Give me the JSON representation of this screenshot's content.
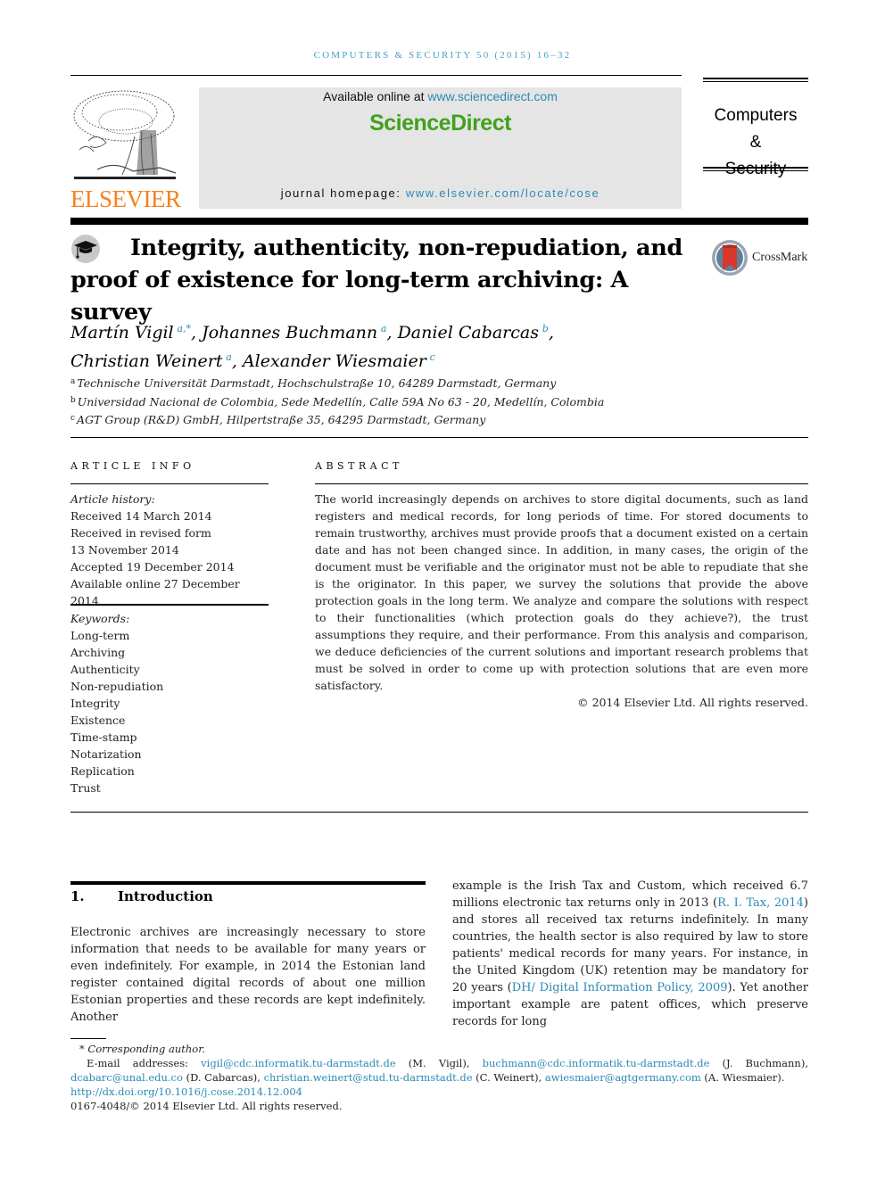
{
  "running_head": "COMPUTERS & SECURITY 50 (2015) 16–32",
  "publisher": {
    "logo_text": "ELSEVIER",
    "logo_color": "#f58220"
  },
  "sciencedirect": {
    "available_prefix": "Available online at ",
    "available_link": "www.sciencedirect.com",
    "brand": "ScienceDirect",
    "brand_color": "#42a11c",
    "homepage_prefix": "journal homepage: ",
    "homepage_link": "www.elsevier.com/locate/cose"
  },
  "journal_box": {
    "line1": "Computers",
    "line2": "&",
    "line3": "Security"
  },
  "article": {
    "title_line1": "Integrity, authenticity, non-repudiation, and",
    "title_line2": "proof of existence for long-term archiving: A survey",
    "crossmark_label": "CrossMark",
    "authors": [
      {
        "name": "Martín Vigil",
        "sup": "a,*",
        "sep": ", "
      },
      {
        "name": "Johannes Buchmann",
        "sup": "a",
        "sep": ", "
      },
      {
        "name": "Daniel Cabarcas",
        "sup": "b",
        "sep": ","
      },
      {
        "name": "Christian Weinert",
        "sup": "a",
        "sep": ", "
      },
      {
        "name": "Alexander Wiesmaier",
        "sup": "c",
        "sep": ""
      }
    ],
    "affiliations": [
      {
        "key": "a",
        "text": "Technische Universität Darmstadt, Hochschulstraße 10, 64289 Darmstadt, Germany"
      },
      {
        "key": "b",
        "text": "Universidad Nacional de Colombia, Sede Medellín, Calle 59A No 63 - 20, Medellín, Colombia"
      },
      {
        "key": "c",
        "text": "AGT Group (R&D) GmbH, Hilpertstraße 35, 64295 Darmstadt, Germany"
      }
    ]
  },
  "article_info": {
    "heading": "ARTICLE INFO",
    "history_label": "Article history:",
    "history": [
      "Received 14 March 2014",
      "Received in revised form",
      "13 November 2014",
      "Accepted 19 December 2014",
      "Available online 27 December 2014"
    ],
    "keywords_label": "Keywords:",
    "keywords": [
      "Long-term",
      "Archiving",
      "Authenticity",
      "Non-repudiation",
      "Integrity",
      "Existence",
      "Time-stamp",
      "Notarization",
      "Replication",
      "Trust"
    ]
  },
  "abstract": {
    "heading": "ABSTRACT",
    "text": "The world increasingly depends on archives to store digital documents, such as land registers and medical records, for long periods of time. For stored documents to remain trustworthy, archives must provide proofs that a document existed on a certain date and has not been changed since. In addition, in many cases, the origin of the document must be verifiable and the originator must not be able to repudiate that she is the originator. In this paper, we survey the solutions that provide the above protection goals in the long term. We analyze and compare the solutions with respect to their functionalities (which protection goals do they achieve?), the trust assumptions they require, and their performance. From this analysis and comparison, we deduce deficiencies of the current solutions and important research problems that must be solved in order to come up with protection solutions that are even more satisfactory.",
    "copyright": "© 2014 Elsevier Ltd. All rights reserved."
  },
  "intro": {
    "number": "1.",
    "heading": "Introduction",
    "left_text": "Electronic archives are increasingly necessary to store information that needs to be available for many years or even indefinitely. For example, in 2014 the Estonian land register contained digital records of about one million Estonian properties and these records are kept indefinitely. Another",
    "right_p1": "example is the Irish Tax and Custom, which received 6.7 millions electronic tax returns only in 2013 (",
    "right_ref1": "R. I. Tax, 2014",
    "right_p2": ") and stores all received tax returns indefinitely. In many countries, the health sector is also required by law to store patients' medical records for many years. For instance, in the United Kingdom (UK) retention may be mandatory for 20 years (",
    "right_ref2": "DH/ Digital Information Policy, 2009",
    "right_p3": "). Yet another important example are patent offices, which preserve records for long"
  },
  "footnotes": {
    "corresponding": "* Corresponding author.",
    "email_label": "E-mail addresses: ",
    "emails": [
      {
        "addr": "vigil@cdc.informatik.tu-darmstadt.de",
        "who": " (M. Vigil), "
      },
      {
        "addr": "buchmann@cdc.informatik.tu-darmstadt.de",
        "who": " (J. Buchmann), "
      },
      {
        "addr": "dcabarc@unal.edu.co",
        "who": " (D. Cabarcas), "
      },
      {
        "addr": "christian.weinert@stud.tu-darmstadt.de",
        "who": " (C. Weinert), "
      },
      {
        "addr": "awiesmaier@agtgermany.com",
        "who": " (A. Wiesmaier)."
      }
    ],
    "doi": "http://dx.doi.org/10.1016/j.cose.2014.12.004",
    "issn_copyright": "0167-4048/© 2014 Elsevier Ltd. All rights reserved."
  },
  "colors": {
    "link": "#2a8ab5",
    "running_head": "#4a9fc4",
    "header_bg": "#e5e5e5"
  }
}
